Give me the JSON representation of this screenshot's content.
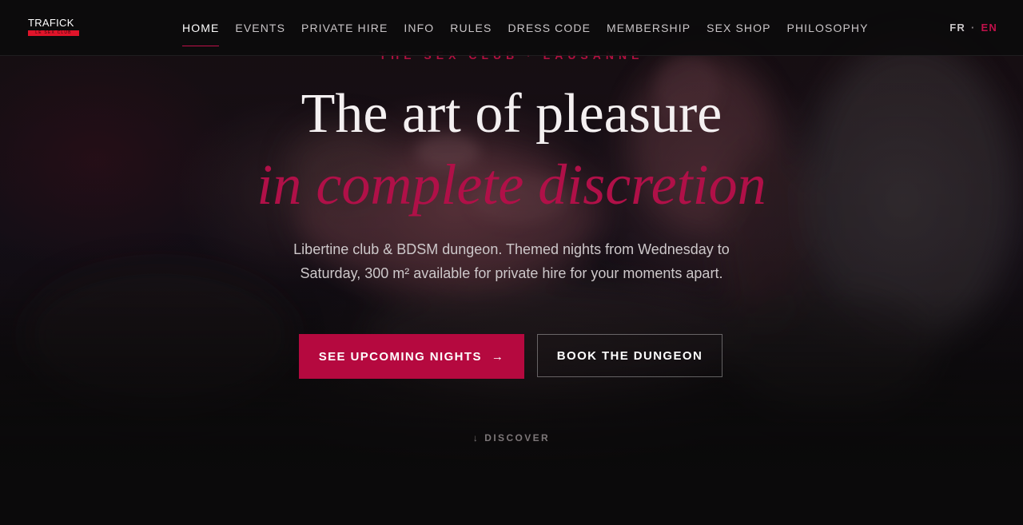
{
  "brand": {
    "logo_text": "TRAFICK",
    "logo_strip_text": "LE SEX CLUB",
    "logo_strip_color": "#e0142a"
  },
  "nav": {
    "items": [
      {
        "label": "HOME",
        "active": true
      },
      {
        "label": "EVENTS",
        "active": false
      },
      {
        "label": "PRIVATE HIRE",
        "active": false
      },
      {
        "label": "INFO",
        "active": false
      },
      {
        "label": "RULES",
        "active": false
      },
      {
        "label": "DRESS CODE",
        "active": false
      },
      {
        "label": "MEMBERSHIP",
        "active": false
      },
      {
        "label": "SEX SHOP",
        "active": false
      },
      {
        "label": "PHILOSOPHY",
        "active": false
      }
    ],
    "lang": {
      "fr": "FR",
      "separator": "·",
      "en": "EN",
      "active": "EN"
    }
  },
  "hero": {
    "eyebrow": "THE SEX CLUB · LAUSANNE",
    "title": "The art of pleasure",
    "subtitle": "in complete discretion",
    "lead": "Libertine club & BDSM dungeon. Themed nights from Wednesday to Saturday, 300 m² available for private hire for your moments apart.",
    "primary_button": {
      "label": "SEE UPCOMING NIGHTS",
      "icon": "arrow-right-icon",
      "icon_glyph": "→"
    },
    "secondary_button": {
      "label": "BOOK THE DUNGEON"
    },
    "discover": {
      "label": "DISCOVER",
      "icon": "arrow-down-icon",
      "icon_glyph": "↓"
    }
  },
  "colors": {
    "accent": "#b5093f",
    "background": "#0b0a0b",
    "text": "#f4f0f1"
  }
}
